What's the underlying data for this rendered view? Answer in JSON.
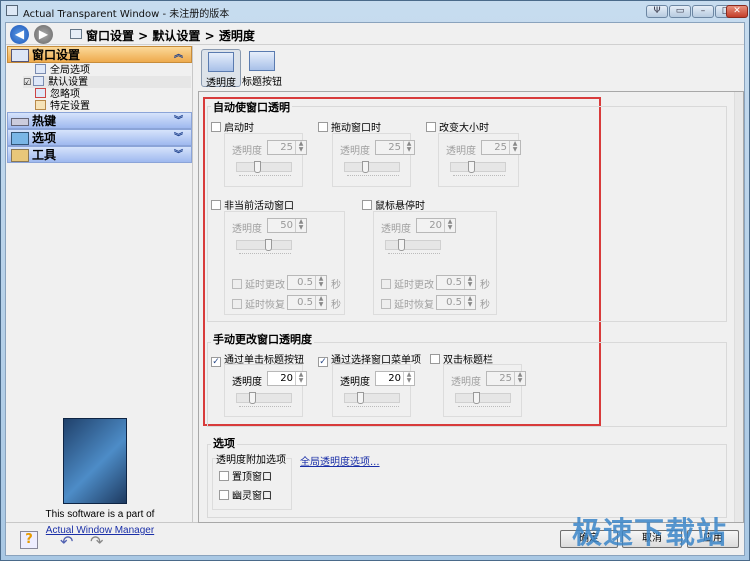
{
  "window": {
    "title": "Actual Transparent Window - 未注册的版本",
    "controls": [
      "pin",
      "restore-small",
      "minimize",
      "maximize",
      "close"
    ]
  },
  "nav": {
    "breadcrumb": "窗口设置 > 默认设置 > 透明度"
  },
  "sidebar": {
    "sections": [
      {
        "label": "窗口设置",
        "expanded": true
      },
      {
        "label": "热键"
      },
      {
        "label": "选项"
      },
      {
        "label": "工具"
      }
    ],
    "tree": [
      {
        "label": "全局选项"
      },
      {
        "label": "默认设置",
        "checked": true,
        "selected": true
      },
      {
        "label": "忽略项"
      },
      {
        "label": "特定设置"
      }
    ],
    "promo_text": "This software is a part of",
    "promo_link": "Actual Window Manager"
  },
  "toolbar": {
    "tabs": [
      {
        "label": "透明度",
        "active": true
      },
      {
        "label": "标题按钮"
      }
    ]
  },
  "auto": {
    "title": "自动使窗口透明",
    "opacity_label": "透明度",
    "items": [
      {
        "label": "启动时",
        "checked": false,
        "value": "25"
      },
      {
        "label": "拖动窗口时",
        "checked": false,
        "value": "25"
      },
      {
        "label": "改变大小时",
        "checked": false,
        "value": "25"
      },
      {
        "label": "非当前活动窗口",
        "checked": false,
        "value": "50",
        "delay_change": "0.5",
        "delay_restore": "0.5"
      },
      {
        "label": "鼠标悬停时",
        "checked": false,
        "value": "20",
        "delay_change": "0.5",
        "delay_restore": "0.5"
      }
    ],
    "delay_change_label": "延时更改",
    "delay_restore_label": "延时恢复",
    "sec": "秒"
  },
  "manual": {
    "title": "手动更改窗口透明度",
    "items": [
      {
        "label": "通过单击标题按钮",
        "checked": true,
        "value": "20"
      },
      {
        "label": "通过选择窗口菜单项",
        "checked": true,
        "value": "20"
      },
      {
        "label": "双击标题栏",
        "checked": false,
        "value": "25"
      }
    ]
  },
  "options": {
    "title": "选项",
    "subgroup": "透明度附加选项",
    "link": "全局透明度选项...",
    "checks": [
      {
        "label": "置顶窗口",
        "checked": false
      },
      {
        "label": "幽灵窗口",
        "checked": false
      }
    ]
  },
  "buttons": {
    "ok": "确定",
    "cancel": "取消",
    "apply": "应用"
  },
  "watermark": "极速下载站",
  "colors": {
    "highlight_box": "#d83b3b",
    "section_active": "#f0b860",
    "section": "#a9c0ef"
  }
}
